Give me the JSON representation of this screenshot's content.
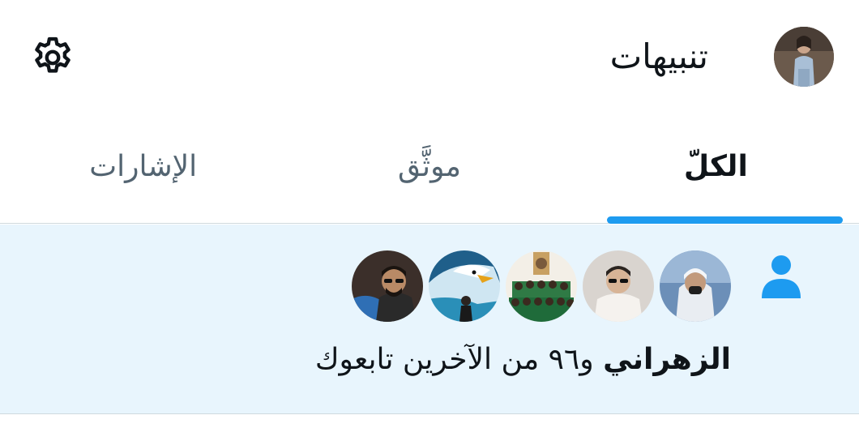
{
  "header": {
    "title": "تنبيهات",
    "profile_avatar_icon": "user-avatar",
    "settings_icon": "gear-icon"
  },
  "tabs": [
    {
      "label": "الكلّ",
      "active": true
    },
    {
      "label": "موثَّق",
      "active": false
    },
    {
      "label": "الإشارات",
      "active": false
    }
  ],
  "notification": {
    "type_icon": "person-icon",
    "actor_name": "الزهراني",
    "message": "و٩٦ من الآخرين تابعوك",
    "avatars": [
      "avatar-1",
      "avatar-2",
      "avatar-3",
      "avatar-4",
      "avatar-5"
    ]
  },
  "colors": {
    "accent": "#1d9bf0",
    "highlight_bg": "#e8f5fd",
    "text_primary": "#0f1419",
    "text_secondary": "#536471",
    "divider": "#cfd9de"
  }
}
